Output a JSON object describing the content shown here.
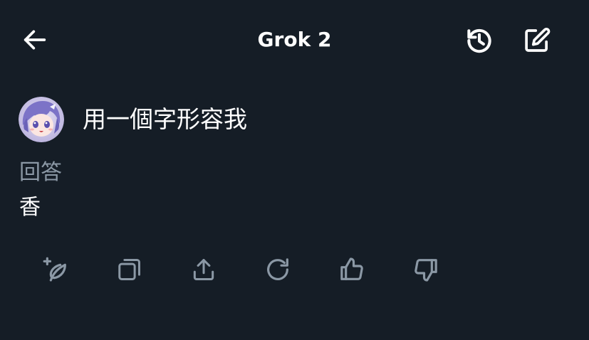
{
  "header": {
    "title": "Grok 2",
    "back_icon": "arrow-left-icon",
    "history_icon": "history-icon",
    "compose_icon": "compose-icon"
  },
  "conversation": {
    "query": "用一個字形容我",
    "answer_label": "回答",
    "answer": "香"
  },
  "actions": [
    {
      "icon": "sparkle-feather-icon"
    },
    {
      "icon": "copy-icon"
    },
    {
      "icon": "share-icon"
    },
    {
      "icon": "regenerate-icon"
    },
    {
      "icon": "thumbs-up-icon"
    },
    {
      "icon": "thumbs-down-icon"
    }
  ],
  "colors": {
    "background": "#151d26",
    "text_primary": "#ffffff",
    "text_secondary": "#8b98a5",
    "icon_muted": "#8b98a5"
  }
}
